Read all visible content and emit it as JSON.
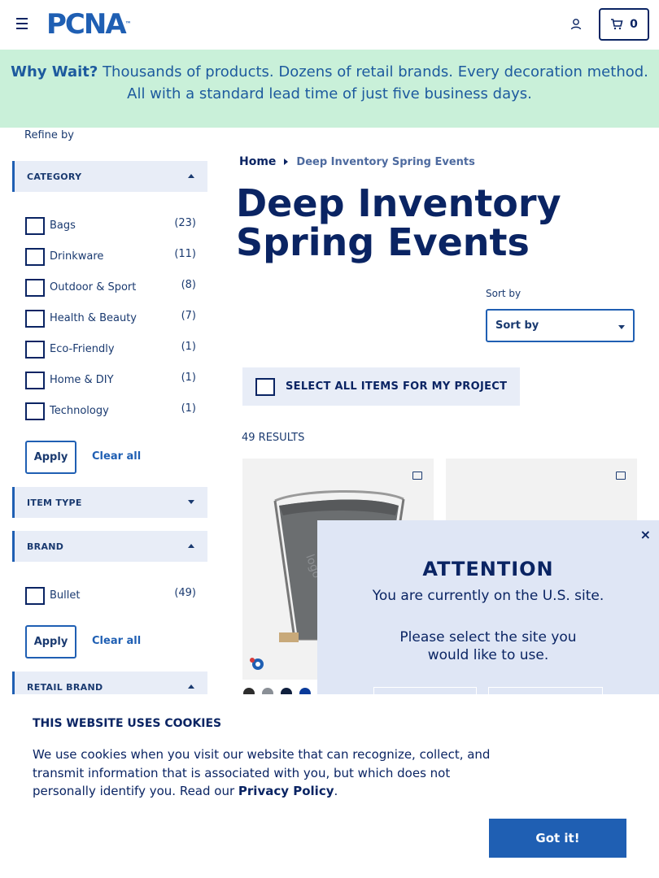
{
  "header": {
    "logo_text": "PCNA",
    "logo_tm": "™",
    "cart_count": "0"
  },
  "banner": {
    "lead": "Why Wait?",
    "text": " Thousands of products. Dozens of retail brands. Every decoration method. All with a standard lead time of just five business days."
  },
  "sidebar": {
    "refine_label": "Refine by",
    "category": {
      "title": "CATEGORY",
      "items": [
        {
          "label": "Bags",
          "count": "(23)"
        },
        {
          "label": "Drinkware",
          "count": "(11)"
        },
        {
          "label": "Outdoor & Sport",
          "count": "(8)"
        },
        {
          "label": "Health & Beauty",
          "count": "(7)"
        },
        {
          "label": "Eco-Friendly",
          "count": "(1)"
        },
        {
          "label": "Home & DIY",
          "count": "(1)"
        },
        {
          "label": "Technology",
          "count": "(1)"
        }
      ],
      "apply": "Apply",
      "clear": "Clear all"
    },
    "item_type": {
      "title": "ITEM TYPE"
    },
    "brand": {
      "title": "BRAND",
      "items": [
        {
          "label": "Bullet",
          "count": "(49)"
        }
      ],
      "apply": "Apply",
      "clear": "Clear all"
    },
    "retail_brand": {
      "title": "RETAIL BRAND"
    }
  },
  "main": {
    "breadcrumb": {
      "home": "Home",
      "current": "Deep Inventory Spring Events"
    },
    "title": "Deep Inventory Spring Events",
    "sort_label": "Sort by",
    "sort_value": "Sort by",
    "select_all": "SELECT ALL ITEMS FOR MY PROJECT",
    "results": "49 RESULTS",
    "swatch_colors": [
      "#2d2d2d",
      "#8a8f96",
      "#0f1f3d",
      "#0a3a9a"
    ]
  },
  "modal": {
    "title": "ATTENTION",
    "line1": "You are currently on the U.S. site.",
    "line2": "Please select the site you would like to use.",
    "close": "×"
  },
  "cookie": {
    "title": "THIS WEBSITE USES COOKIES",
    "text": "We use cookies when you visit our website that can recognize, collect, and transmit information that is associated with you, but which does not personally identify you. Read our ",
    "link": "Privacy Policy",
    "period": ".",
    "button": "Got it!"
  },
  "colors": {
    "navy": "#0a2463",
    "brand_blue": "#1f5fb3",
    "banner_bg": "#c9f0d9",
    "facet_bg": "#e8edf7"
  }
}
